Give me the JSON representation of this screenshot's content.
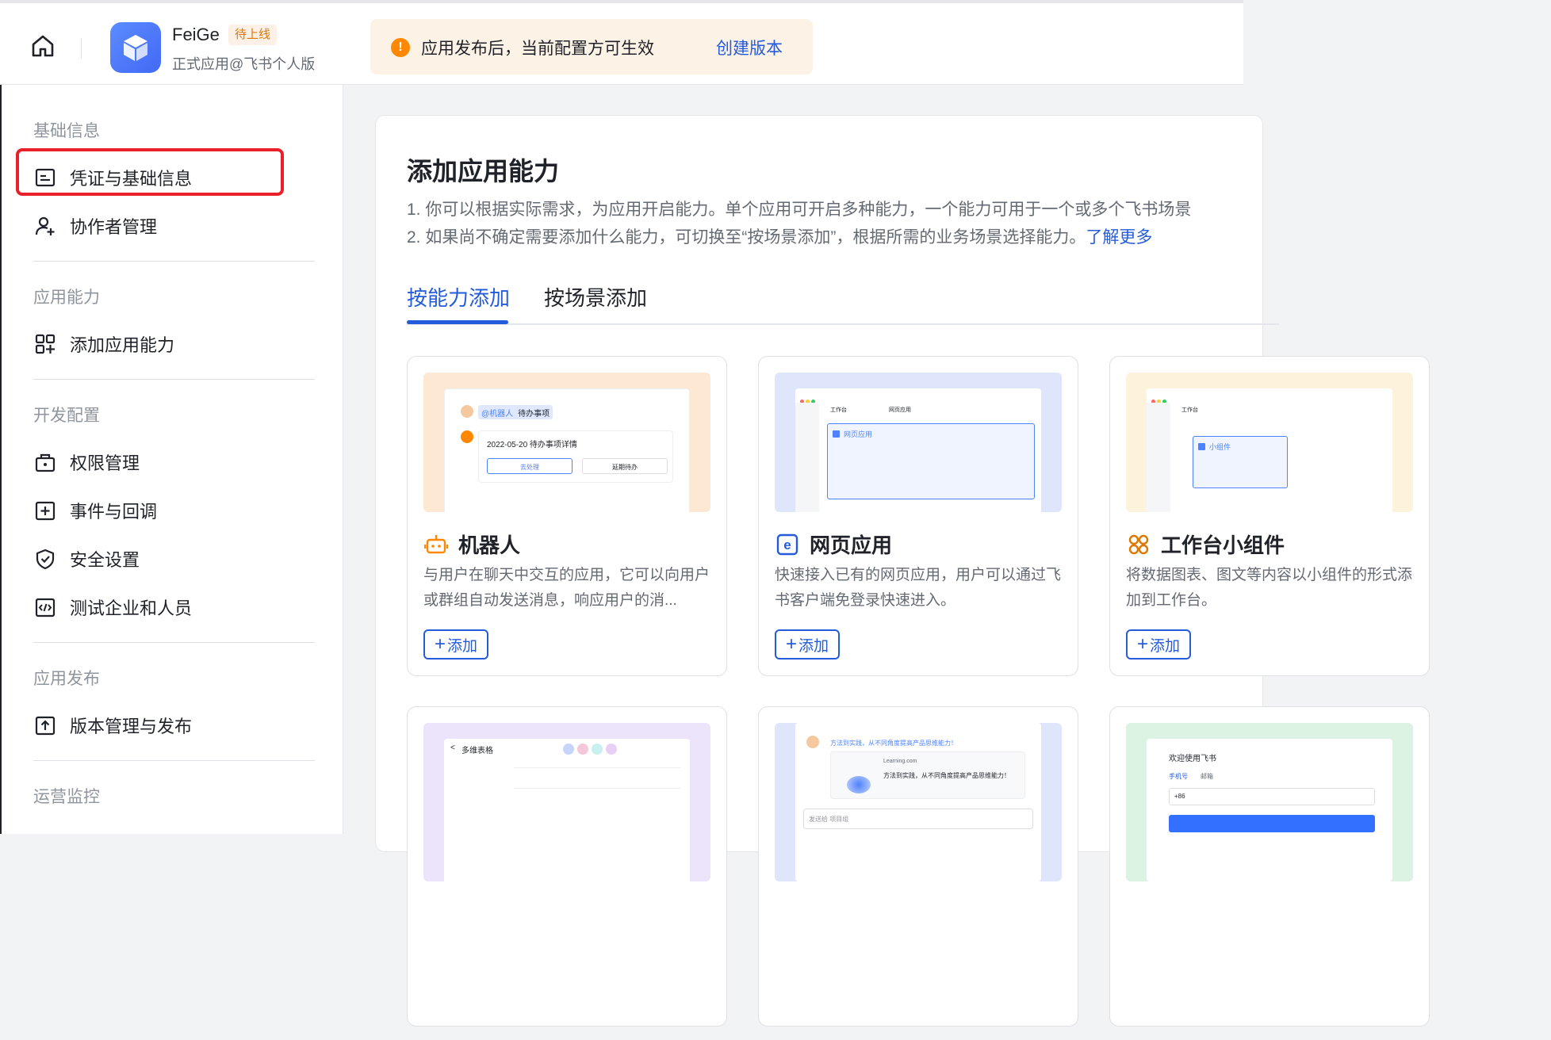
{
  "header": {
    "app_name": "FeiGe",
    "app_status": "待上线",
    "app_subtitle": "正式应用@飞书个人版",
    "notice_text": "应用发布后，当前配置方可生效",
    "notice_link": "创建版本"
  },
  "sidebar": {
    "groups": [
      {
        "title": "基础信息",
        "items": [
          {
            "label": "凭证与基础信息",
            "icon": "id-card-icon"
          },
          {
            "label": "协作者管理",
            "icon": "user-add-icon"
          }
        ]
      },
      {
        "title": "应用能力",
        "items": [
          {
            "label": "添加应用能力",
            "icon": "grid-add-icon"
          }
        ]
      },
      {
        "title": "开发配置",
        "items": [
          {
            "label": "权限管理",
            "icon": "lock-icon"
          },
          {
            "label": "事件与回调",
            "icon": "event-icon"
          },
          {
            "label": "安全设置",
            "icon": "shield-icon"
          },
          {
            "label": "测试企业和人员",
            "icon": "code-icon"
          }
        ]
      },
      {
        "title": "应用发布",
        "items": [
          {
            "label": "版本管理与发布",
            "icon": "upload-icon"
          }
        ]
      },
      {
        "title": "运营监控",
        "items": []
      }
    ]
  },
  "main": {
    "title": "添加应用能力",
    "line1": "1. 你可以根据实际需求，为应用开启能力。单个应用可开启多种能力，一个能力可用于一个或多个飞书场景",
    "line2": "2. 如果尚不确定需要添加什么能力，可切换至“按场景添加”，根据所需的业务场景选择能力。",
    "line2_link": "了解更多",
    "tabs": [
      "按能力添加",
      "按场景添加"
    ],
    "add_label": "添加",
    "cards": [
      {
        "title": "机器人",
        "desc": "与用户在聊天中交互的应用，它可以向用户或群组自动发送消息，响应用户的消...",
        "icon": "robot-icon",
        "accent": "#ff8800"
      },
      {
        "title": "网页应用",
        "desc": "快速接入已有的网页应用，用户可以通过飞书客户端免登录快速进入。",
        "icon": "web-e-icon",
        "accent": "#245bdb"
      },
      {
        "title": "工作台小组件",
        "desc": "将数据图表、图文等内容以小组件的形式添加到工作台。",
        "icon": "widget-icon",
        "accent": "#de7802"
      }
    ],
    "thumbs": {
      "bot_mention": "@机器人",
      "bot_todo": "待办事项",
      "bot_detail": "2022-05-20 待办事项详情",
      "bot_btn1": "去处理",
      "bot_btn2": "延期待办",
      "web_tab1": "工作台",
      "web_tab2": "网页应用",
      "web_item": "网页应用",
      "widget_tab": "工作台",
      "widget_item": "小组件",
      "table_title": "多维表格",
      "link_title": "方法到实践，从不同角度提高产品思维能力！",
      "link_domain": "Learning.com",
      "link_desc": "方法到实践，从不同角度提高产品思维能力！",
      "link_input": "发送给 项目组",
      "login_title": "欢迎使用飞书",
      "login_tab1": "手机号",
      "login_tab2": "邮箱",
      "login_code": "+86"
    }
  }
}
